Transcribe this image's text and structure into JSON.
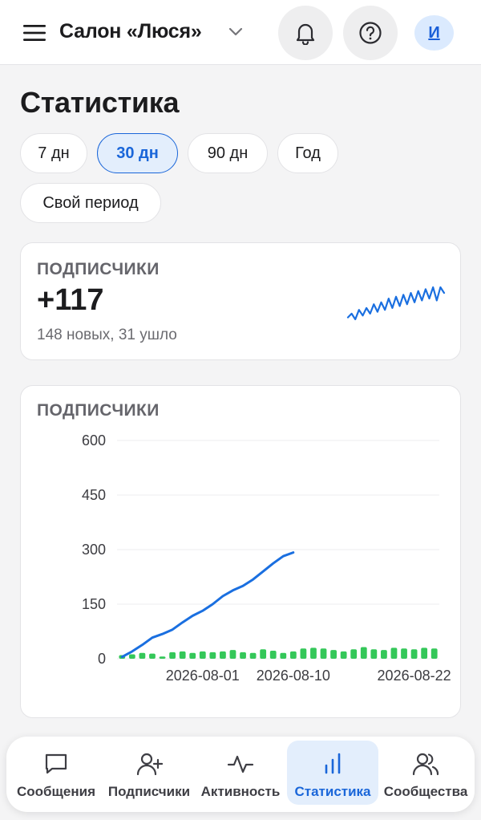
{
  "header": {
    "salon_name": "Салон «Люся»",
    "avatar_letter": "И",
    "icons": [
      "menu-icon",
      "chevron-down-icon",
      "bell-icon",
      "help-icon"
    ]
  },
  "page": {
    "title": "Статистика"
  },
  "periods": [
    {
      "label": "7 дн",
      "active": false
    },
    {
      "label": "30 дн",
      "active": true
    },
    {
      "label": "90 дн",
      "active": false
    },
    {
      "label": "Год",
      "active": false
    },
    {
      "label": "Свой период",
      "active": false
    }
  ],
  "summary": {
    "label": "подписчики",
    "value": "+117",
    "detail": "148 новых, 31 ушло",
    "sparkline": [
      3,
      5,
      2,
      7,
      4,
      8,
      5,
      10,
      6,
      11,
      7,
      13,
      8,
      14,
      9,
      15,
      10,
      16,
      11,
      17,
      12,
      18,
      13,
      19,
      12,
      19,
      16
    ]
  },
  "chart_card": {
    "label": "подписчики"
  },
  "chart_data": {
    "type": "line",
    "title": "подписчики",
    "ylim": [
      0,
      600
    ],
    "yticks": [
      0,
      150,
      300,
      450,
      600
    ],
    "x": [
      "2026-07-24",
      "2026-07-25",
      "2026-07-26",
      "2026-07-27",
      "2026-07-28",
      "2026-07-29",
      "2026-07-30",
      "2026-07-31",
      "2026-08-01",
      "2026-08-02",
      "2026-08-03",
      "2026-08-04",
      "2026-08-05",
      "2026-08-06",
      "2026-08-07",
      "2026-08-08",
      "2026-08-09",
      "2026-08-10",
      "2026-08-11",
      "2026-08-12",
      "2026-08-13",
      "2026-08-14",
      "2026-08-15",
      "2026-08-16",
      "2026-08-17",
      "2026-08-18",
      "2026-08-19",
      "2026-08-20",
      "2026-08-21",
      "2026-08-22",
      "2026-08-23",
      "2026-08-24"
    ],
    "xticks": [
      "2026-08-01",
      "2026-08-10",
      "2026-08-22"
    ],
    "grid": true,
    "series": [
      {
        "type": "line",
        "color": "#1a6fe0",
        "values": [
          5,
          20,
          38,
          58,
          68,
          80,
          100,
          118,
          132,
          150,
          172,
          188,
          200,
          218,
          240,
          262,
          282,
          292
        ]
      },
      {
        "type": "bar",
        "color": "#34c759",
        "values": [
          10,
          12,
          16,
          14,
          6,
          18,
          20,
          16,
          20,
          18,
          20,
          24,
          18,
          16,
          26,
          22,
          16,
          20,
          28,
          30,
          28,
          24,
          20,
          26,
          32,
          26,
          24,
          30,
          28,
          26,
          30,
          28
        ]
      }
    ]
  },
  "nav": [
    {
      "label": "Сообщения",
      "icon": "chat-icon",
      "active": false
    },
    {
      "label": "Подписчики",
      "icon": "user-add-icon",
      "active": false
    },
    {
      "label": "Активность",
      "icon": "activity-icon",
      "active": false
    },
    {
      "label": "Статистика",
      "icon": "bar-chart-icon",
      "active": true
    },
    {
      "label": "Сообщества",
      "icon": "users-icon",
      "active": false
    }
  ]
}
